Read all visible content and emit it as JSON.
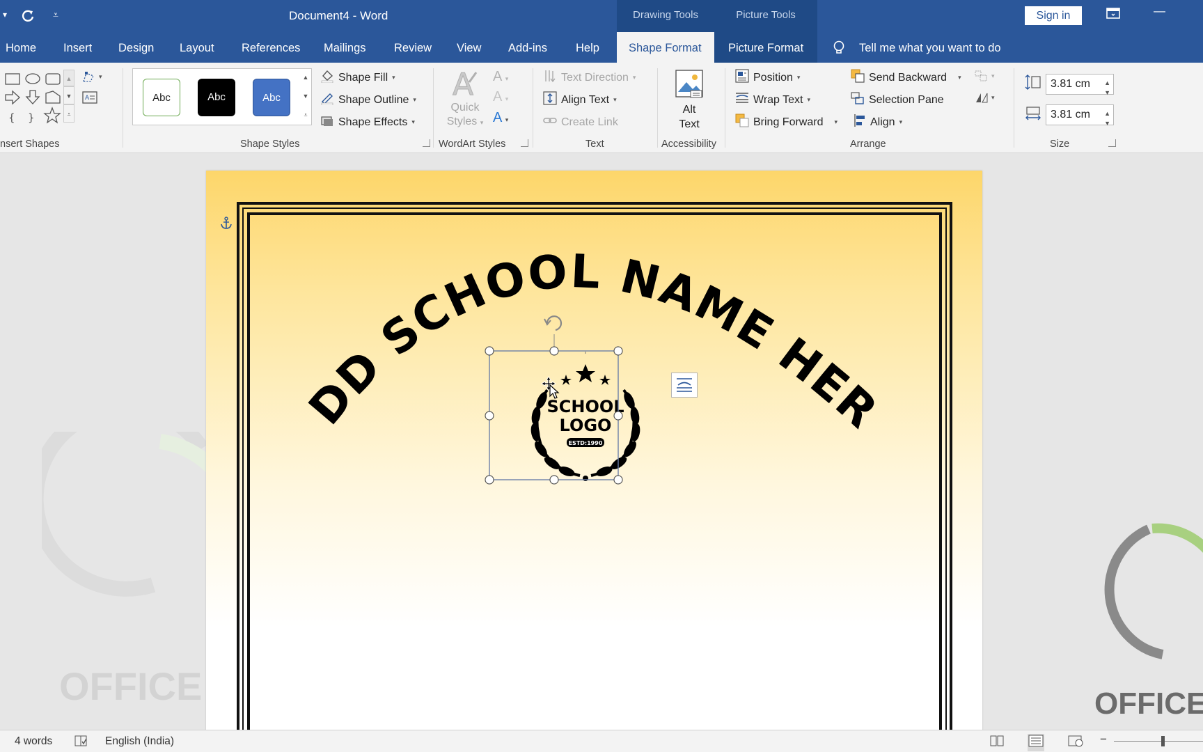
{
  "titlebar": {
    "doc_title": "Document4  -  Word",
    "context_groups": [
      "Drawing Tools",
      "Picture Tools"
    ],
    "sign_in": "Sign in",
    "minimize": "—"
  },
  "tabs": {
    "items": [
      "Home",
      "Insert",
      "Design",
      "Layout",
      "References",
      "Mailings",
      "Review",
      "View",
      "Add-ins",
      "Help"
    ],
    "shape_format": "Shape Format",
    "picture_format": "Picture Format",
    "tell_me": "Tell me what you want to do"
  },
  "ribbon": {
    "insert_shapes_label": "nsert Shapes",
    "shape_styles": {
      "swatches": [
        "Abc",
        "Abc",
        "Abc"
      ],
      "shape_fill": "Shape Fill",
      "shape_outline": "Shape Outline",
      "shape_effects": "Shape Effects",
      "group_label": "Shape Styles"
    },
    "wordart": {
      "quick_styles_1": "Quick",
      "quick_styles_2": "Styles",
      "group_label": "WordArt Styles"
    },
    "text": {
      "text_direction": "Text Direction",
      "align_text": "Align Text",
      "create_link": "Create Link",
      "group_label": "Text"
    },
    "accessibility": {
      "alt_1": "Alt",
      "alt_2": "Text",
      "group_label": "Accessibility"
    },
    "arrange": {
      "position": "Position",
      "wrap_text": "Wrap Text",
      "bring_forward": "Bring Forward",
      "send_backward": "Send Backward",
      "selection_pane": "Selection Pane",
      "align": "Align",
      "group_label": "Arrange"
    },
    "size": {
      "height": "3.81 cm",
      "width": "3.81 cm",
      "group_label": "Size"
    }
  },
  "document": {
    "arched_title": "ADD SCHOOL NAME HERE",
    "logo_line1": "SCHOOL",
    "logo_line2": "LOGO",
    "logo_estd": "ESTD:1990",
    "watermark_left": "OFFICE DES",
    "watermark_right": "OFFICE DES"
  },
  "statusbar": {
    "word_count": "4 words",
    "language": "English (India)"
  },
  "colors": {
    "word_blue": "#2b579a",
    "context_blue": "#1f4a86",
    "page_gold": "#fdd66a",
    "watermark_green": "#a8d080"
  }
}
